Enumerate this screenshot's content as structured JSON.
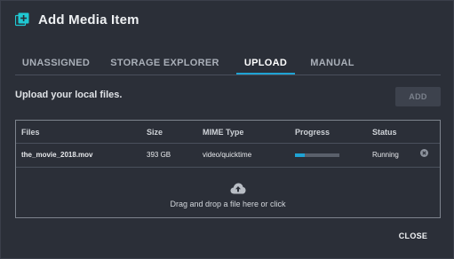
{
  "dialog": {
    "title": "Add Media Item",
    "icon": "add-media-icon",
    "accent_color": "#1fa3d4"
  },
  "tabs": [
    {
      "label": "UNASSIGNED",
      "active": false
    },
    {
      "label": "STORAGE EXPLORER",
      "active": false
    },
    {
      "label": "UPLOAD",
      "active": true
    },
    {
      "label": "MANUAL",
      "active": false
    }
  ],
  "upload": {
    "instruction": "Upload your local files.",
    "add_label": "ADD"
  },
  "table": {
    "columns": [
      "Files",
      "Size",
      "MIME Type",
      "Progress",
      "Status"
    ],
    "rows": [
      {
        "file": "the_movie_2018.mov",
        "size": "393 GB",
        "mime": "video/quicktime",
        "progress": 0.22,
        "status": "Running",
        "remove_icon": "remove-circle-icon"
      }
    ]
  },
  "dropzone": {
    "icon": "cloud-upload-icon",
    "text": "Drag and drop a file here or click"
  },
  "footer": {
    "close_label": "CLOSE"
  }
}
